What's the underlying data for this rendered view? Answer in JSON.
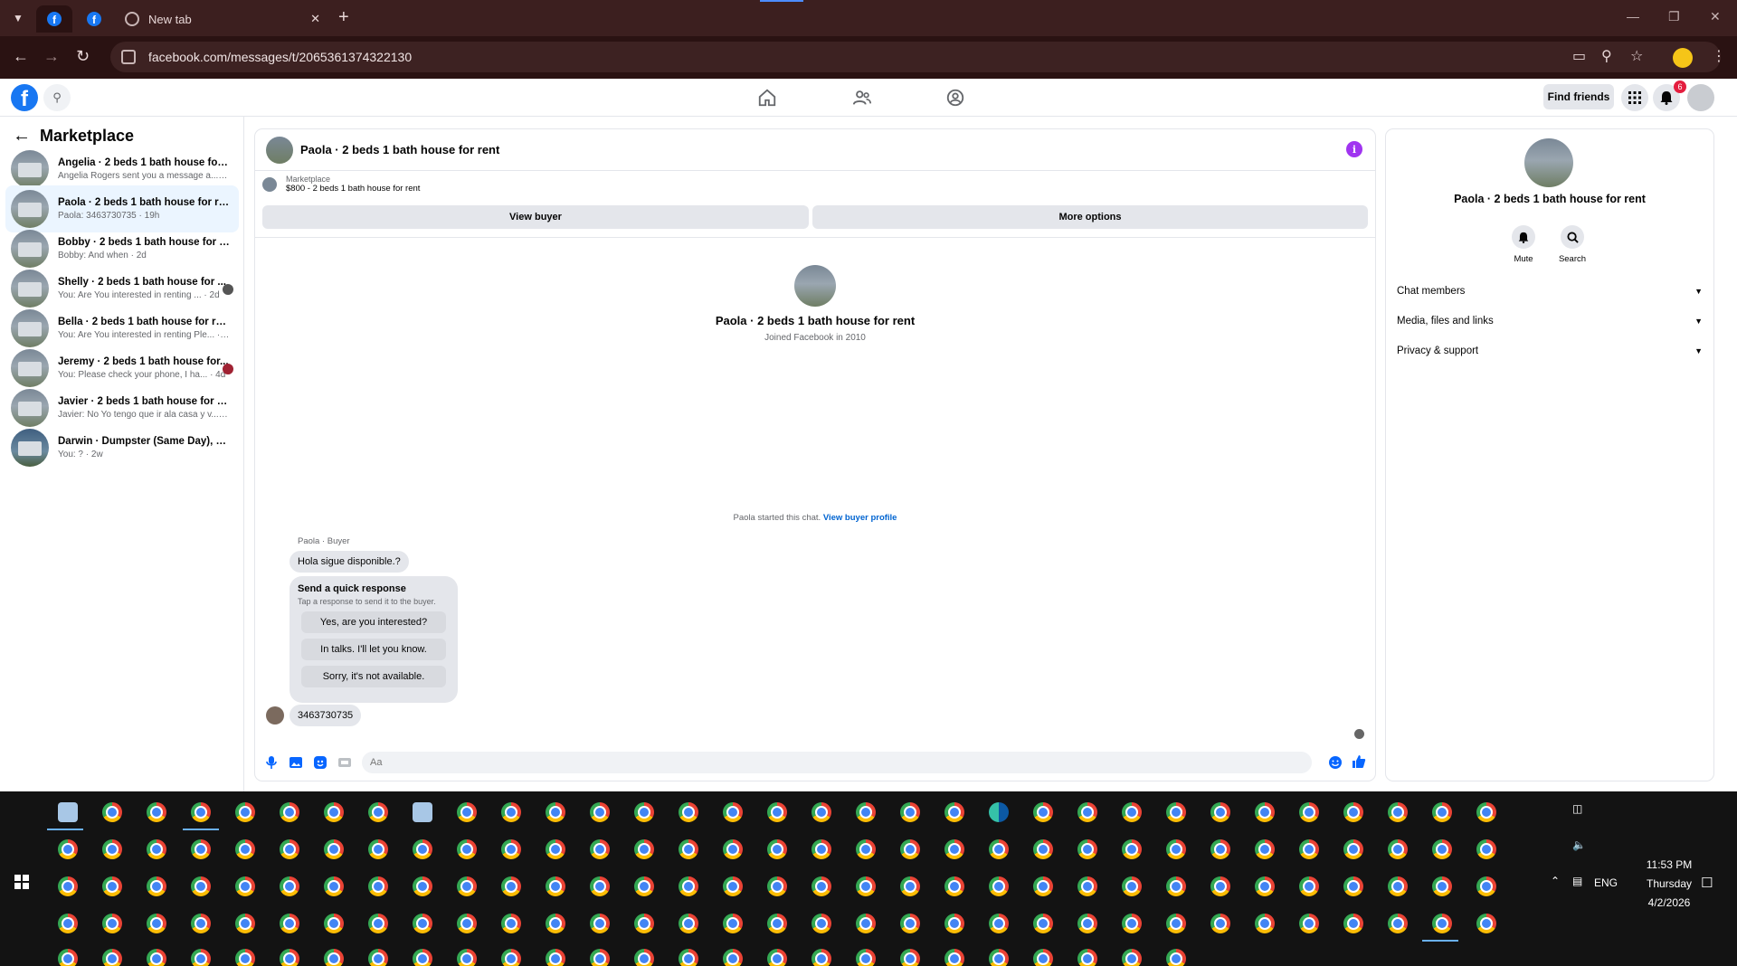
{
  "browser": {
    "tab_new_label": "New tab",
    "url": "facebook.com/messages/t/2065361374322130"
  },
  "fb": {
    "find_friends": "Find friends",
    "notifications_count": "6"
  },
  "sidebar": {
    "title": "Marketplace",
    "conversations": [
      {
        "title": "Angelia · 2 beds 1 bath house for r...",
        "sub": "Angelia Rogers sent you a message a... · 7h"
      },
      {
        "title": "Paola · 2 beds 1 bath house for rent",
        "sub": "Paola: 3463730735 · 19h"
      },
      {
        "title": "Bobby · 2 beds 1 bath house for rent",
        "sub": "Bobby: And when · 2d"
      },
      {
        "title": "Shelly · 2 beds 1 bath house for ...",
        "sub": "You: Are You interested in renting ... · 2d"
      },
      {
        "title": "Bella · 2 beds 1 bath house for rent",
        "sub": "You: Are You interested in renting Ple... · 2d"
      },
      {
        "title": "Jeremy · 2 beds 1 bath house for...",
        "sub": "You: Please check your phone, I ha... · 4d"
      },
      {
        "title": "Javier · 2 beds 1 bath house for rent",
        "sub": "Javier: No Yo tengo que ir ala casa y v... · 5d"
      },
      {
        "title": "Darwin · Dumpster (Same Day), Re...",
        "sub": "You: ? · 2w"
      }
    ]
  },
  "chat": {
    "header_title": "Paola · 2 beds 1 bath house for rent",
    "listing_label": "Marketplace",
    "listing_price": "$800 - 2 beds 1 bath house for rent",
    "view_buyer": "View buyer",
    "more_options": "More options",
    "profile_name": "Paola · 2 beds 1 bath house for rent",
    "profile_joined": "Joined Facebook in 2010",
    "started_text": "Paola started this chat.",
    "started_link": "View buyer profile",
    "sender_label": "Paola · Buyer",
    "message_1": "Hola sigue disponible.?",
    "quick_title": "Send a quick response",
    "quick_sub": "Tap a response to send it to the buyer.",
    "quick_replies": [
      "Yes, are you interested?",
      "In talks. I'll let you know.",
      "Sorry, it's not available."
    ],
    "message_2": "3463730735",
    "composer_placeholder": "Aa"
  },
  "info_panel": {
    "name": "Paola · 2 beds 1 bath house for rent",
    "mute": "Mute",
    "search": "Search",
    "sections": [
      "Chat members",
      "Media, files and links",
      "Privacy & support"
    ]
  },
  "taskbar": {
    "time": "11:53 PM",
    "day": "Thursday",
    "date": "4/2/2026",
    "lang": "ENG"
  },
  "colors": {
    "fb_blue": "#1877f2",
    "active_convo": "#ebf5ff",
    "link_blue": "#0064d1",
    "info_purple": "#a034f0",
    "browser_frame": "#3c1f1f"
  }
}
